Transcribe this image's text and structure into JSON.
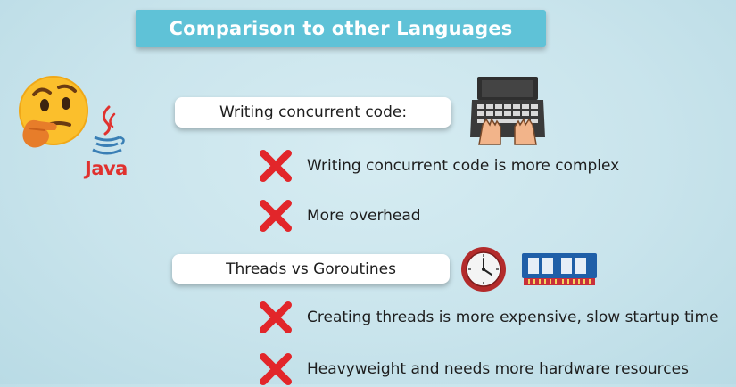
{
  "title": "Comparison to other Languages",
  "java_label": "Java",
  "sections": [
    {
      "heading": "Writing concurrent code:",
      "points": [
        "Writing concurrent code is more complex",
        "More overhead"
      ]
    },
    {
      "heading": "Threads vs Goroutines",
      "points": [
        "Creating threads is more expensive, slow startup time",
        "Heavyweight and needs more hardware resources"
      ]
    }
  ],
  "icons": {
    "thinking": "thinking-face-icon",
    "java": "java-logo-icon",
    "laptop": "laptop-typing-icon",
    "clock": "clock-icon",
    "ram": "memory-chip-icon",
    "cross": "cross-mark-icon"
  },
  "colors": {
    "banner": "#5fc2d7",
    "cross": "#e2262a",
    "java_red": "#e0312e",
    "java_blue": "#3a7fb5"
  }
}
